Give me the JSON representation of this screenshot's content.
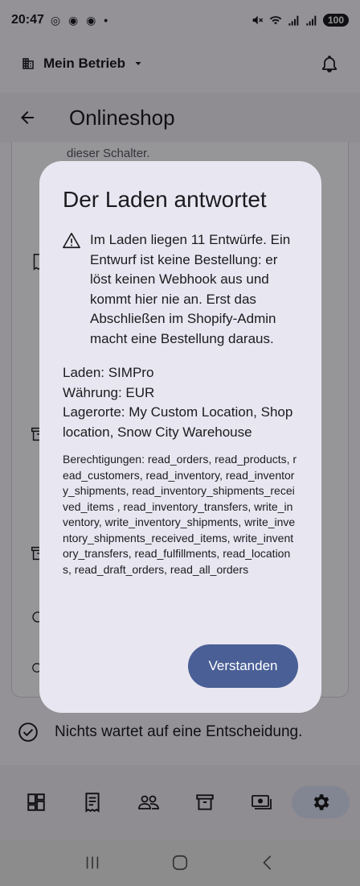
{
  "status_bar": {
    "time": "20:47",
    "notification_icons": "◎ ◉ ◉ •",
    "battery": "100"
  },
  "top_bar": {
    "business_label": "Mein Betrieb"
  },
  "title_bar": {
    "title": "Onlineshop"
  },
  "background": {
    "hint_text": "dieser Schalter.",
    "status_text": "Nichts wartet auf eine Entscheidung."
  },
  "dialog": {
    "title": "Der Laden antwortet",
    "warning_text": "Im Laden liegen 11 Entwürfe. Ein Entwurf ist keine Bestellung: er löst keinen Webhook aus und kommt hier nie an. Erst das Abschließen im Shopify-Admin macht eine Bestellung daraus.",
    "shop_line": "Laden: SIMPro",
    "currency_line": "Währung: EUR",
    "locations_line": "Lagerorte: My Custom Location, Shop location, Snow City Warehouse",
    "permissions_text": "Berechtigungen: read_orders, read_products, read_customers, read_inventory, read_inventory_shipments, read_inventory_shipments_received_items , read_inventory_transfers, write_inventory, write_inventory_shipments, write_inventory_shipments_received_items, write_inventory_transfers, read_fulfillments, read_locations, read_draft_orders, read_all_orders",
    "confirm_label": "Verstanden"
  },
  "bottom_nav": {
    "items": [
      "dashboard-icon",
      "orders-icon",
      "customers-icon",
      "inventory-icon",
      "payments-icon",
      "settings-icon"
    ],
    "active": "settings-icon"
  },
  "colors": {
    "primary": "#4a5f96",
    "dialog_bg": "#e8e6f0",
    "nav_active": "#d9def3"
  }
}
